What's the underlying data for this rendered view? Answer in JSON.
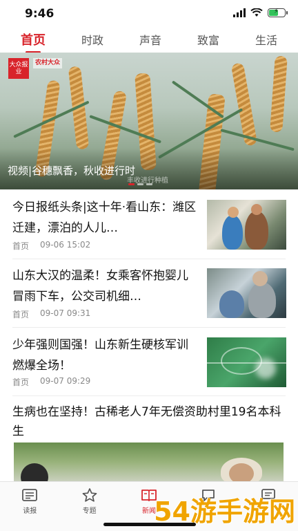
{
  "status": {
    "time": "9:46"
  },
  "tabs": [
    {
      "label": "首页",
      "active": true
    },
    {
      "label": "时政",
      "active": false
    },
    {
      "label": "声音",
      "active": false
    },
    {
      "label": "致富",
      "active": false
    },
    {
      "label": "生活",
      "active": false
    }
  ],
  "hero": {
    "caption": "视频|谷穗飘香，秋收进行时",
    "logo_text": "大众报业",
    "logo2_text": "农村大众",
    "sub_text": "丰收进行种植",
    "slide_index": 1,
    "slide_count": 3
  },
  "news": [
    {
      "title": "今日报纸头条|这十年·看山东：潍区迁建，漂泊的人儿…",
      "source": "首页",
      "time": "09-06 15:02"
    },
    {
      "title": "山东大汉的温柔！女乘客怀抱婴儿冒雨下车，公交司机细…",
      "source": "首页",
      "time": "09-07 09:31"
    },
    {
      "title": "少年强则国强！山东新生硬核军训燃爆全场！",
      "source": "首页",
      "time": "09-07 09:29"
    }
  ],
  "featured": {
    "title": "生病也在坚持！古稀老人7年无偿资助村里19名本科生"
  },
  "bottom_nav": [
    {
      "label": "读报",
      "icon": "newspaper-icon",
      "active": false
    },
    {
      "label": "专题",
      "icon": "star-icon",
      "active": false
    },
    {
      "label": "新闻",
      "icon": "book-icon",
      "active": true
    },
    {
      "label": "",
      "icon": "chat-icon",
      "active": false
    },
    {
      "label": "",
      "icon": "message-icon",
      "active": false
    }
  ],
  "watermark": {
    "text": "54游手游网"
  },
  "colors": {
    "accent": "#d8232a",
    "text": "#111111",
    "meta": "#888888"
  }
}
